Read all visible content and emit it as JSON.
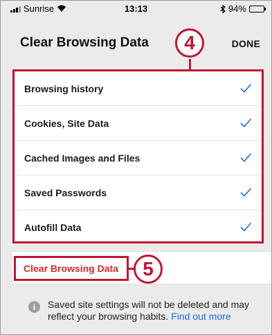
{
  "status": {
    "carrier": "Sunrise",
    "time": "13:13",
    "battery_text": "94%",
    "battery_level": 0.94,
    "wifi_icon": "wifi-icon",
    "bluetooth_icon": "bluetooth-icon"
  },
  "header": {
    "title": "Clear Browsing Data",
    "done_label": "DONE"
  },
  "callouts": {
    "first": "4",
    "second": "5"
  },
  "options": [
    {
      "label": "Browsing history",
      "checked": true
    },
    {
      "label": "Cookies, Site Data",
      "checked": true
    },
    {
      "label": "Cached Images and Files",
      "checked": true
    },
    {
      "label": "Saved Passwords",
      "checked": true
    },
    {
      "label": "Autofill Data",
      "checked": true
    }
  ],
  "clear_button": {
    "label": "Clear Browsing Data"
  },
  "info": {
    "text": "Saved site settings will not be deleted and may reflect your browsing habits.",
    "link": "Find out more",
    "icon": "info-icon"
  },
  "colors": {
    "accent": "#c01634",
    "destructive": "#d62b2b",
    "link": "#1a6fd8",
    "check": "#1a6fd8"
  }
}
